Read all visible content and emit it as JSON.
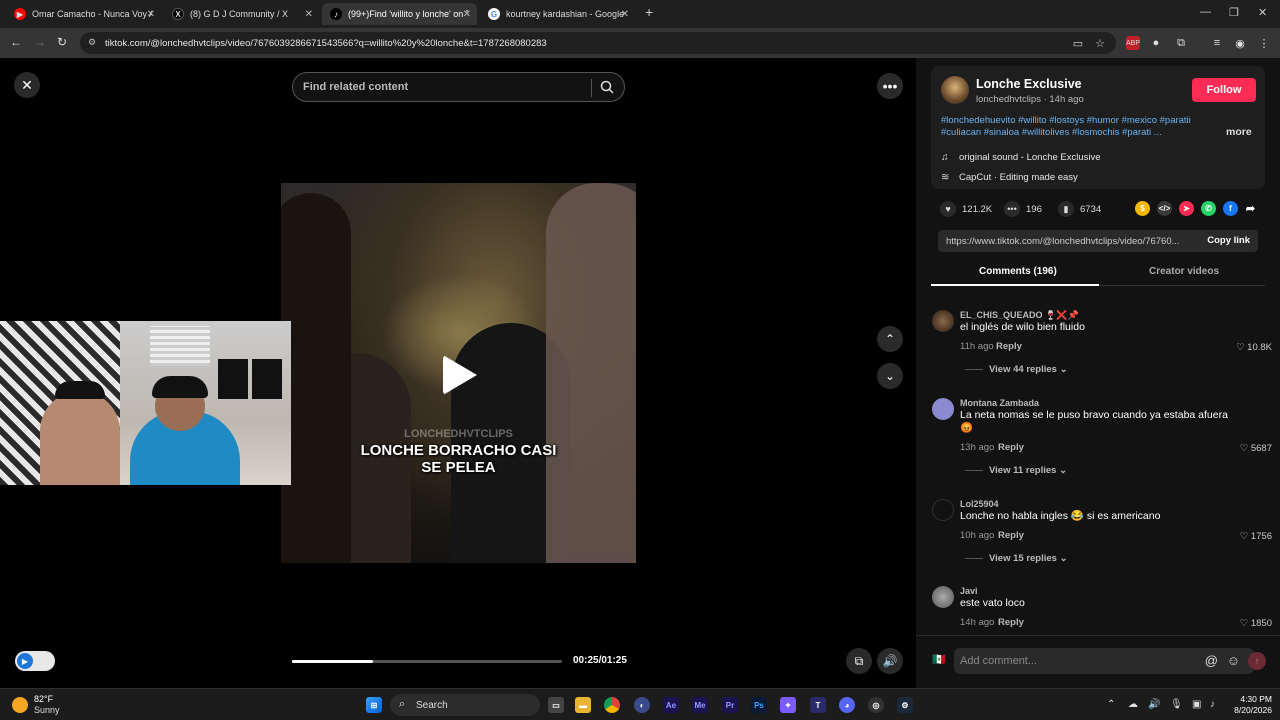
{
  "browser": {
    "tabs": [
      {
        "label": "Omar Camacho - Nunca Voy A",
        "icon": "youtube-icon",
        "color": "#ff0000"
      },
      {
        "label": "(8) G D J Community / X",
        "icon": "x-icon",
        "color": "#000000"
      },
      {
        "label": "(99+)Find 'willito y lonche' on T",
        "icon": "tiktok-icon",
        "color": "#000000"
      },
      {
        "label": "kourtney kardashian - Google S",
        "icon": "google-icon",
        "color": "#4285f4"
      }
    ],
    "url": "tiktok.com/@lonchedhvtclips/video/7676039286671543566?q=willito%20y%20lonche&t=1787268080283"
  },
  "player": {
    "search_placeholder": "Find related content",
    "watermark": "LONCHEDHVTCLIPS",
    "caption_line1": "LONCHE BORRACHO CASI",
    "caption_line2": "SE PELEA",
    "progress": 0.3,
    "time": "00:25/01:25"
  },
  "post": {
    "author_name": "Lonche Exclusive",
    "author_handle": "lonchedhvtclips",
    "author_time": "14h ago",
    "author_sub": "lonchedhvtclips · 14h ago",
    "follow_label": "Follow",
    "hashtags": "#lonchedehuevito #willito #lostoys #humor #mexico #paratii #culiacan #sinaloa #willitolives #losmochis #parati ...",
    "more_label": "more",
    "sound": "original sound - Lonche Exclusive",
    "capcut": "CapCut · Editing made easy",
    "likes": "121.2K",
    "comments": "196",
    "saves": "6734",
    "link": "https://www.tiktok.com/@lonchedhvtclips/video/76760...",
    "copy_link_label": "Copy link",
    "tab_comments": "Comments (196)",
    "tab_creator": "Creator videos",
    "share_colors": {
      "coin": "#f5b700",
      "embed": "#3a3a3a",
      "friends": "#fe2c55",
      "whatsapp": "#25d366",
      "facebook": "#1877f2"
    }
  },
  "comments": [
    {
      "user": "EL_CHIS_QUEADO",
      "text": "el inglés de wilo bien fluido",
      "time": "11h ago",
      "reply": "Reply",
      "likes": "10.8K",
      "view": "View 44 replies"
    },
    {
      "user": "Montana Zambada",
      "text": "La neta nomas se le puso bravo cuando ya estaba afuera",
      "time": "13h ago",
      "reply": "Reply",
      "likes": "5687",
      "view": "View 11 replies"
    },
    {
      "user": "Lol25904",
      "text": "Lonche no habla ingles 😂 si es americano",
      "time": "10h ago",
      "reply": "Reply",
      "likes": "1756",
      "view": "View 15 replies"
    },
    {
      "user": "Javi",
      "text": "este vato loco",
      "time": "14h ago",
      "reply": "Reply",
      "likes": "1850",
      "view": ""
    }
  ],
  "comment_input_placeholder": "Add comment...",
  "taskbar": {
    "temp": "82°F",
    "condition": "Sunny",
    "search": "Search",
    "time": "4:30 PM",
    "date": "8/20/2026"
  }
}
